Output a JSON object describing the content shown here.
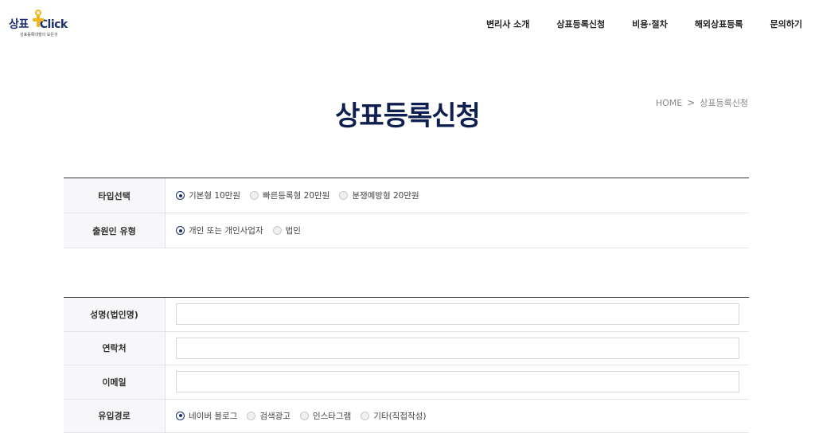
{
  "logo": {
    "name_prefix": "상표",
    "name_suffix": "Click",
    "tagline": "상표등록대행의 모든것"
  },
  "nav": {
    "items": [
      "변리사 소개",
      "상표등록신청",
      "비용·절차",
      "해외상표등록",
      "문의하기"
    ]
  },
  "page": {
    "title": "상표등록신청"
  },
  "breadcrumb": {
    "home": "HOME",
    "separator": ">",
    "current": "상표등록신청"
  },
  "type_section": {
    "rows": [
      {
        "label": "타입선택",
        "options": [
          {
            "label": "기본형 10만원",
            "checked": true
          },
          {
            "label": "빠른등록형 20만원",
            "checked": false
          },
          {
            "label": "분쟁예방형 20만원",
            "checked": false
          }
        ]
      },
      {
        "label": "출원인 유형",
        "options": [
          {
            "label": "개인 또는 개인사업자",
            "checked": true
          },
          {
            "label": "법인",
            "checked": false
          }
        ]
      }
    ]
  },
  "applicant_section": {
    "name_label": "성명(법인명)",
    "name_value": "",
    "phone_label": "연락처",
    "phone_value": "",
    "email_label": "이메일",
    "email_value": "",
    "source_label": "유입경로",
    "source_options": [
      {
        "label": "네이버 블로그",
        "checked": true
      },
      {
        "label": "검색광고",
        "checked": false
      },
      {
        "label": "인스타그램",
        "checked": false
      },
      {
        "label": "기타(직접작성)",
        "checked": false
      }
    ]
  },
  "colors": {
    "brand_navy": "#0e1f4f",
    "brand_yellow": "#f2b51b",
    "radio_checked": "#1e2f6e"
  }
}
